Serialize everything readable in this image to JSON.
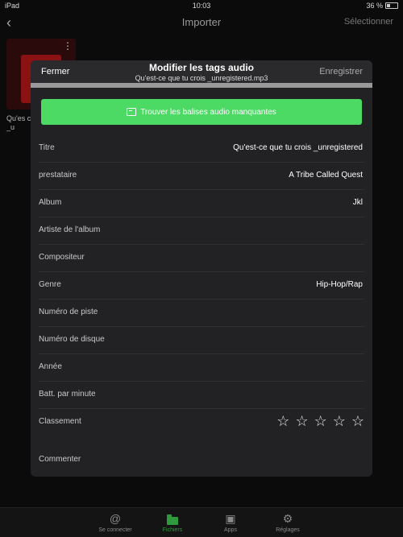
{
  "status_bar": {
    "device": "iPad",
    "time": "10:03",
    "battery": "36 %"
  },
  "nav": {
    "back_icon": "chevron-left-icon",
    "title": "Importer",
    "select_label": "Sélectionner"
  },
  "background_file": {
    "caption": "Qu'es crois _u"
  },
  "modal": {
    "close_label": "Fermer",
    "title": "Modifier les tags audio",
    "subtitle": "Qu'est-ce que tu crois _unregistered.mp3",
    "save_label": "Enregistrer",
    "find_button_label": "Trouver les balises audio manquantes",
    "fields": [
      {
        "label": "Titre",
        "value": "Qu'est-ce que tu crois _unregistered"
      },
      {
        "label": "prestataire",
        "value": "A Tribe Called Quest"
      },
      {
        "label": "Album",
        "value": "Jkl"
      },
      {
        "label": "Artiste de l'album",
        "value": ""
      },
      {
        "label": "Compositeur",
        "value": ""
      },
      {
        "label": "Genre",
        "value": "Hip-Hop/Rap"
      },
      {
        "label": "Numéro de piste",
        "value": ""
      },
      {
        "label": "Numéro de disque",
        "value": ""
      },
      {
        "label": "Année",
        "value": ""
      },
      {
        "label": "Batt. par minute",
        "value": ""
      }
    ],
    "rating": {
      "label": "Classement",
      "stars_filled": 0,
      "stars_total": 5,
      "star_glyph": "☆"
    },
    "comment": {
      "label": "Commenter"
    }
  },
  "tab_bar": {
    "tabs": [
      {
        "label": "Se connecter",
        "icon": "at-icon",
        "glyph": "@",
        "active": false
      },
      {
        "label": "Fichiers",
        "icon": "folder-icon",
        "glyph": "",
        "active": true
      },
      {
        "label": "Apps",
        "icon": "apps-icon",
        "glyph": "▣",
        "active": false
      },
      {
        "label": "Réglages",
        "icon": "gear-icon",
        "glyph": "⚙",
        "active": false
      }
    ]
  },
  "colors": {
    "accent_green": "#4cd964",
    "tab_active": "#2e9a3d",
    "modal_bg": "#222224"
  }
}
